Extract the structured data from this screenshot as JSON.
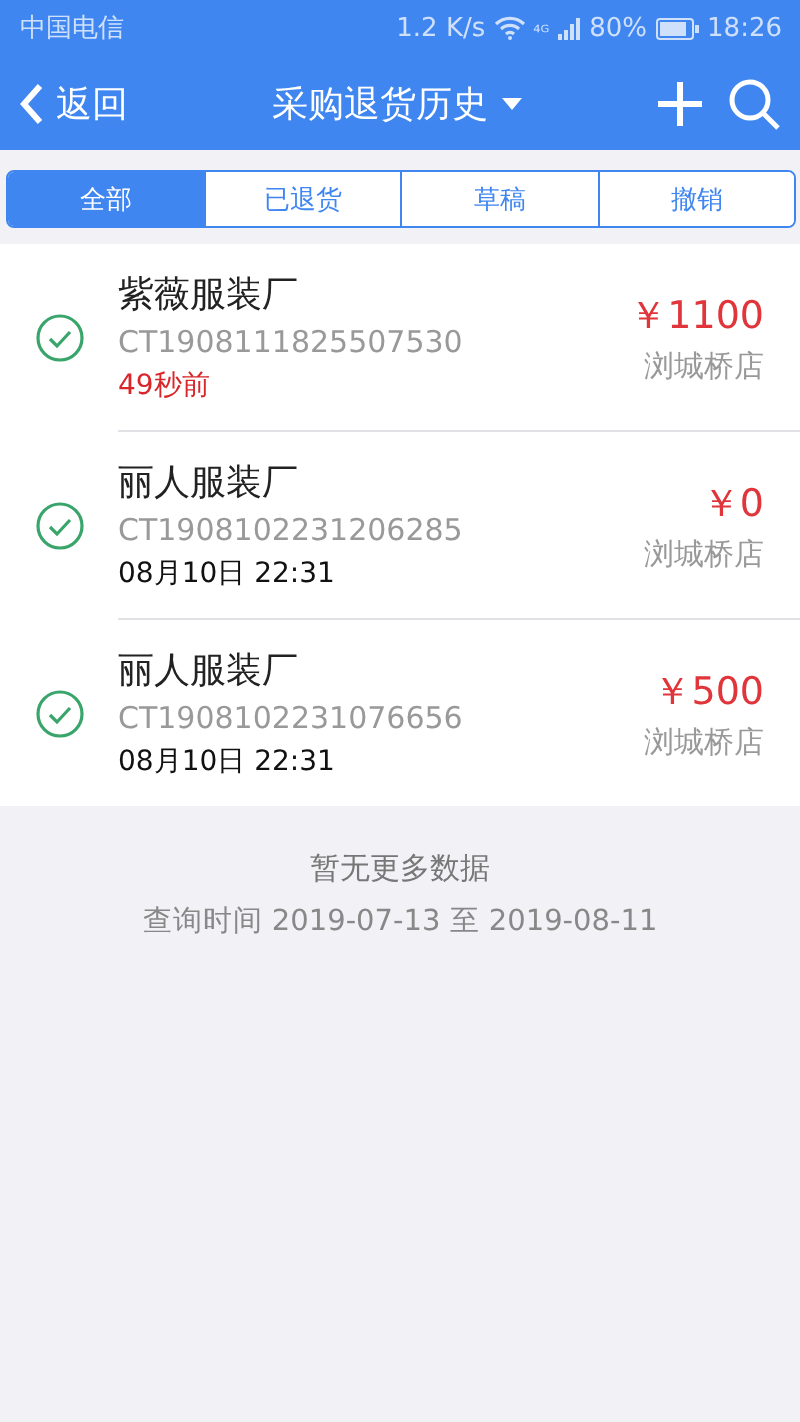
{
  "status_bar": {
    "carrier": "中国电信",
    "speed": "1.2 K/s",
    "network": "⁴ᴳ",
    "battery": "80%",
    "time": "18:26"
  },
  "nav": {
    "back": "返回",
    "title": "采购退货历史"
  },
  "tabs": [
    {
      "label": "全部",
      "selected": true
    },
    {
      "label": "已退货",
      "selected": false
    },
    {
      "label": "草稿",
      "selected": false
    },
    {
      "label": "撤销",
      "selected": false
    }
  ],
  "orders": [
    {
      "supplier": "紫薇服装厂",
      "number": "CT1908111825507530",
      "time": "49秒前",
      "kind": "relative",
      "amount": "￥1100",
      "store": "浏城桥店",
      "checked": true
    },
    {
      "supplier": "丽人服装厂",
      "number": "CT1908102231206285",
      "time": "08月10日 22:31",
      "kind": "absolute",
      "amount": "￥0",
      "store": "浏城桥店",
      "checked": true
    },
    {
      "supplier": "丽人服装厂",
      "number": "CT1908102231076656",
      "time": "08月10日 22:31",
      "kind": "absolute",
      "amount": "￥500",
      "store": "浏城桥店",
      "checked": true
    }
  ],
  "footer": {
    "message": "暂无更多数据",
    "query_range": "查询时间 2019-07-13 至 2019-08-11"
  }
}
